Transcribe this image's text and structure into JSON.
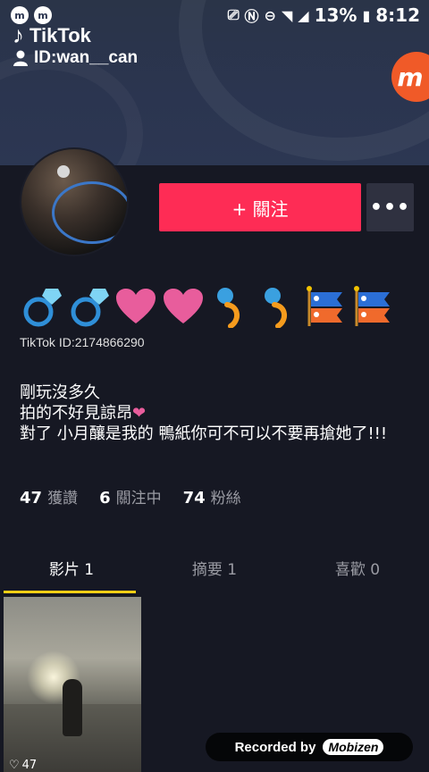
{
  "status_bar": {
    "battery": "13%",
    "time": "8:12"
  },
  "header": {
    "app_name": "TikTok",
    "user_id": "ID:wan__can"
  },
  "overlay": {
    "badge": "m"
  },
  "profile": {
    "follow_label": "+ 關注",
    "more_label": "•••",
    "tiktok_id": "TikTok ID:2174866290",
    "bio_lines": [
      "剛玩沒多久",
      "拍的不好見諒昂",
      "對了 小月釀是我的 鴨紙你可不可以不要再搶她了!!!"
    ],
    "stats": [
      {
        "value": "47",
        "label": "獲讚"
      },
      {
        "value": "6",
        "label": "關注中"
      },
      {
        "value": "74",
        "label": "粉絲"
      }
    ]
  },
  "tabs": [
    {
      "label": "影片 1"
    },
    {
      "label": "摘要 1"
    },
    {
      "label": "喜歡 0"
    }
  ],
  "video": {
    "likes": "47"
  },
  "recorder": {
    "text": "Recorded by",
    "brand": "Mobizen"
  },
  "colors": {
    "accent": "#fe2c55",
    "tab_indicator": "#face15",
    "background": "#161823"
  }
}
